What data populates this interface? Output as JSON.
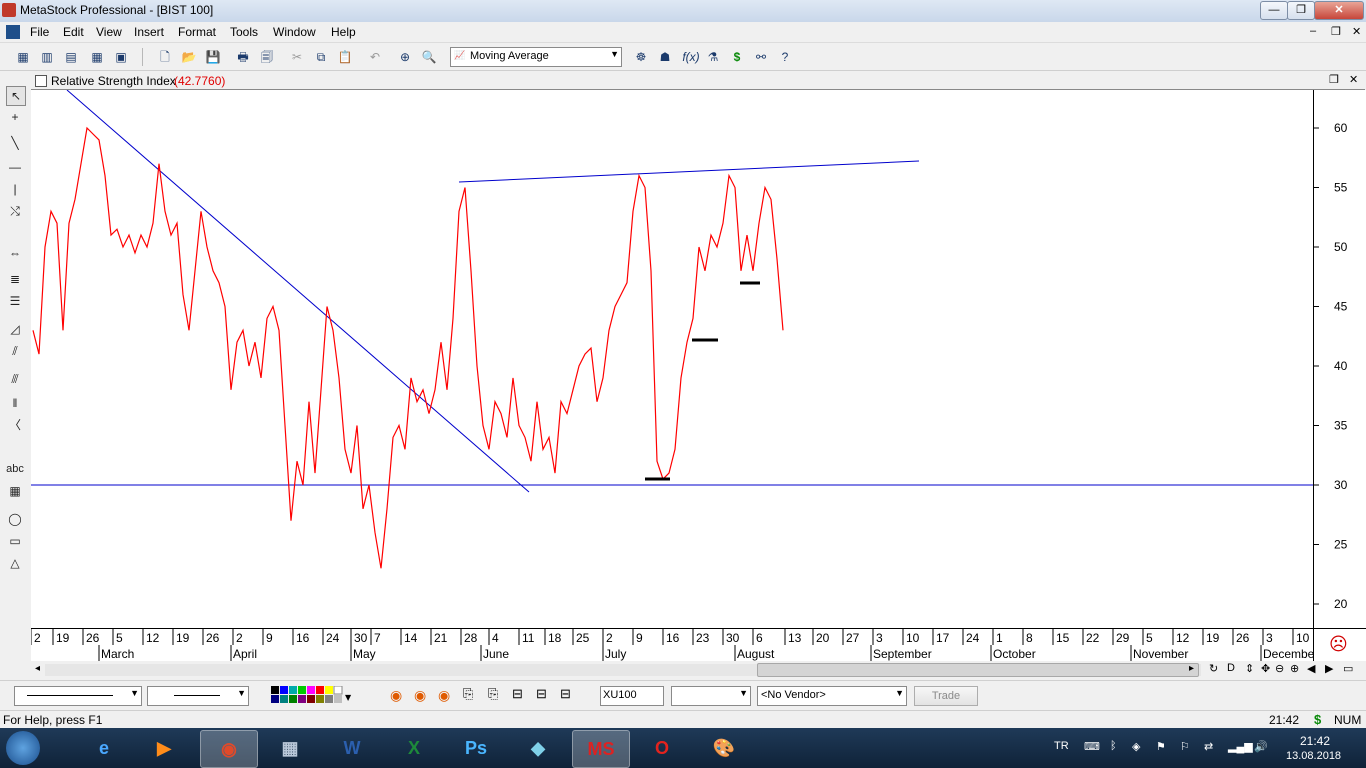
{
  "window": {
    "title": "MetaStock Professional - [BIST 100]"
  },
  "menu": [
    "File",
    "Edit",
    "View",
    "Insert",
    "Format",
    "Tools",
    "Window",
    "Help"
  ],
  "toolbar": {
    "indicator_select": "Moving Average"
  },
  "chart": {
    "indicator_name": "Relative Strength Index",
    "indicator_value": "(42.7760)",
    "indicator_color": "#ff0000",
    "trendline_color": "#0000cc"
  },
  "chart_data": {
    "type": "line",
    "series": [],
    "yticks": [
      60,
      55,
      50,
      45,
      40,
      35,
      30,
      25,
      20
    ],
    "ylim": [
      18,
      63
    ],
    "horizontal_line": 30,
    "x_day_labels": [
      "2",
      "19",
      "26",
      "5",
      "12",
      "19",
      "26",
      "2",
      "9",
      "16",
      "24",
      "30",
      "7",
      "14",
      "21",
      "28",
      "4",
      "11",
      "18",
      "25",
      "2",
      "9",
      "16",
      "23",
      "30",
      "6",
      "13",
      "20",
      "27",
      "3",
      "10",
      "17",
      "24",
      "1",
      "8",
      "15",
      "22",
      "29",
      "5",
      "12",
      "19",
      "26",
      "3",
      "10"
    ],
    "x_month_labels": [
      "March",
      "April",
      "May",
      "June",
      "July",
      "August",
      "September",
      "October",
      "November",
      "December"
    ],
    "rsi_values": [
      43,
      41,
      50,
      53,
      52,
      43,
      52,
      54,
      57,
      60,
      59.5,
      59,
      56,
      51,
      51.5,
      50,
      51,
      49.5,
      51,
      50,
      52,
      57,
      53,
      51,
      52,
      46,
      43,
      48,
      53,
      50,
      48,
      47,
      45,
      38,
      42,
      43,
      40,
      42,
      39,
      44,
      45,
      43,
      35,
      27,
      32,
      30,
      37,
      31,
      38,
      45,
      43,
      39,
      33,
      31,
      35,
      28,
      30,
      26,
      23,
      28,
      34,
      35,
      33,
      39,
      37,
      38,
      36,
      38,
      42,
      38,
      44,
      53,
      55,
      48,
      40,
      35,
      33,
      37,
      36,
      34,
      39,
      35,
      34,
      32,
      37,
      33,
      34,
      31,
      37,
      36,
      38,
      40,
      41,
      41.5,
      37,
      39,
      43,
      45,
      46,
      47,
      53,
      56,
      55,
      48,
      32,
      30.5,
      31,
      33,
      39,
      42,
      44,
      50,
      48,
      51,
      50,
      52,
      56,
      55,
      48,
      51,
      48,
      52,
      55,
      54,
      49,
      43
    ]
  },
  "bottom": {
    "symbol_value": "XU100",
    "vendor_value": "<No Vendor>",
    "trade_label": "Trade"
  },
  "status": {
    "help_text": "For Help, press F1",
    "time": "21:42",
    "dollar": "$",
    "num": "NUM"
  },
  "taskbar": {
    "lang": "TR",
    "clock_time": "21:42",
    "clock_date": "13.08.2018"
  },
  "icons": [
    "start-orb-icon",
    "internet-explorer-icon",
    "media-player-icon",
    "chrome-icon",
    "calculator-icon",
    "word-icon",
    "excel-icon",
    "photoshop-icon",
    "notepad-icon",
    "metastock-icon",
    "opera-icon",
    "paint-icon"
  ]
}
